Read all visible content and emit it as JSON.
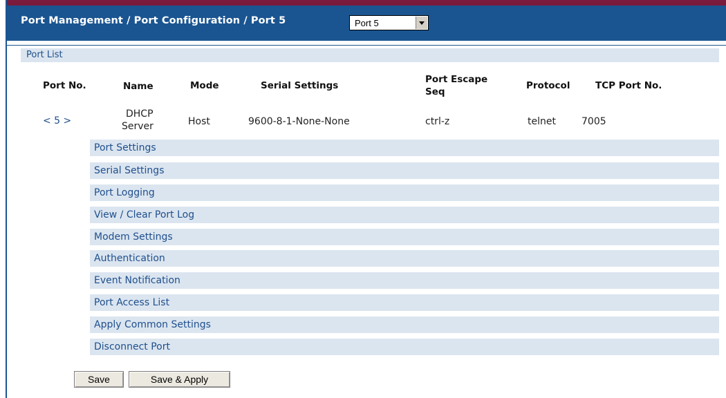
{
  "header": {
    "title": "Port Management / Port Configuration / Port 5",
    "port_select": {
      "value": "Port 5"
    }
  },
  "port_list": {
    "label": "Port List",
    "columns": [
      "Port No.",
      "Name",
      "Mode",
      "Serial Settings",
      "Port Escape",
      "Seq",
      "Protocol",
      "TCP Port No."
    ],
    "row": {
      "port_no": "< 5 >",
      "name_line1": "DHCP",
      "name_line2": "Server",
      "mode": "Host",
      "serial_settings": "9600-8-1-None-None",
      "escape_seq": "ctrl-z",
      "protocol": "telnet",
      "tcp_port": "7005"
    }
  },
  "menu": [
    "Port Settings",
    "Serial Settings",
    "Port Logging",
    "View / Clear Port Log",
    "Modem Settings",
    "Authentication",
    "Event Notification",
    "Port Access List",
    "Apply Common Settings",
    "Disconnect Port"
  ],
  "buttons": {
    "save": "Save",
    "save_apply": "Save & Apply"
  },
  "colors": {
    "header_bg": "#1a5591",
    "top_strip": "#7a1a3c",
    "row_bg": "#dbe5f0",
    "link": "#1f4f8c"
  }
}
